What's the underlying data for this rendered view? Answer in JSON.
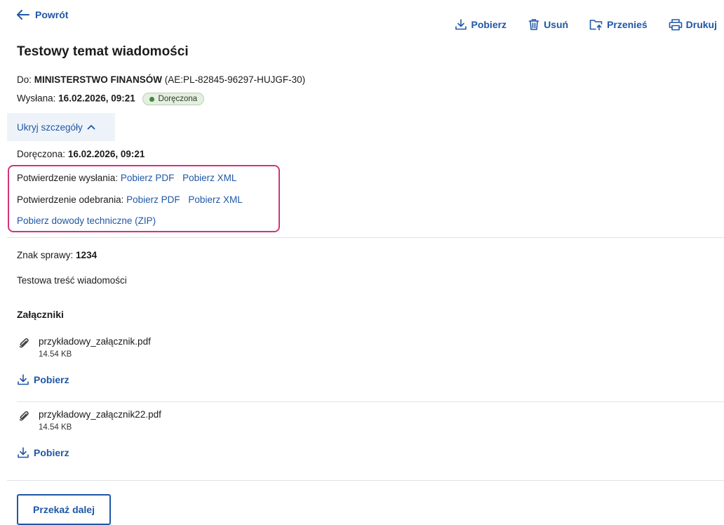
{
  "nav": {
    "back_label": "Powrót"
  },
  "toolbar": {
    "download": "Pobierz",
    "delete": "Usuń",
    "move": "Przenieś",
    "print": "Drukuj"
  },
  "message": {
    "subject": "Testowy temat wiadomości",
    "to_label": "Do:",
    "to_name": "MINISTERSTWO FINANSÓW",
    "to_address": "(AE:PL-82845-96297-HUJGF-30)",
    "sent_label": "Wysłana:",
    "sent_date": "16.02.2026, 09:21",
    "status": "Doręczona",
    "toggle_label": "Ukryj szczegóły",
    "delivered_label": "Doręczona:",
    "delivered_date": "16.02.2026, 09:21",
    "confirmation_sent_label": "Potwierdzenie wysłania:",
    "confirmation_received_label": "Potwierdzenie odebrania:",
    "pdf_link": "Pobierz PDF",
    "xml_link": "Pobierz XML",
    "evidence_link": "Pobierz dowody techniczne (ZIP)",
    "case_label": "Znak sprawy:",
    "case_number": "1234",
    "body": "Testowa treść wiadomości"
  },
  "attachments": {
    "title": "Załączniki",
    "download_label": "Pobierz",
    "items": [
      {
        "name": "przykładowy_załącznik.pdf",
        "size": "14.54 KB"
      },
      {
        "name": "przykładowy_załącznik22.pdf",
        "size": "14.54 KB"
      }
    ]
  },
  "footer": {
    "forward_label": "Przekaż dalej"
  },
  "colors": {
    "accent": "#1f57a7",
    "highlight": "#d0357a",
    "status_green": "#3c8a3a"
  }
}
